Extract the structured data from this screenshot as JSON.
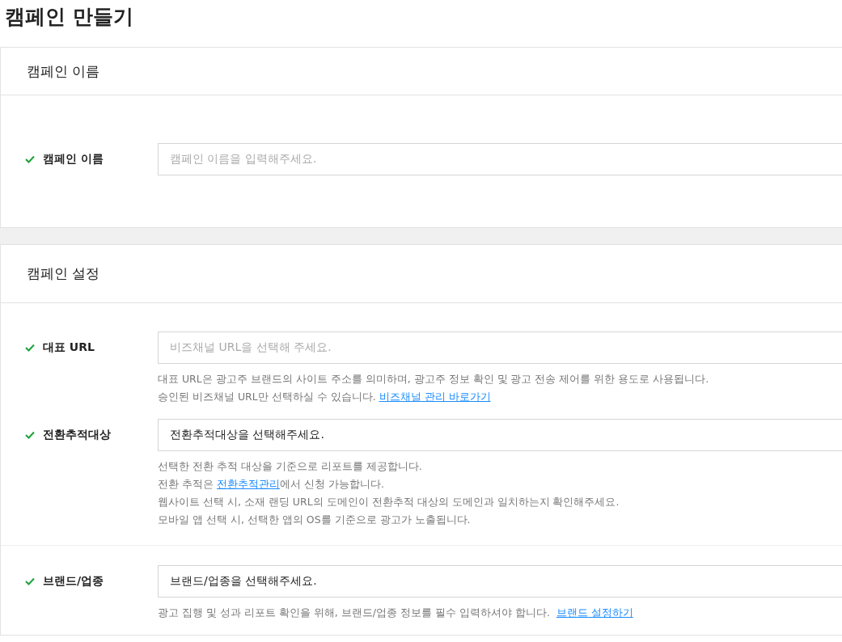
{
  "page_title": "캠페인 만들기",
  "sections": [
    {
      "title": "캠페인 이름",
      "fields": [
        {
          "label": "캠페인 이름",
          "valid": true,
          "kind": "input",
          "placeholder": "캠페인 이름을 입력해주세요."
        }
      ]
    },
    {
      "title": "캠페인 설정",
      "fields": [
        {
          "label": "대표 URL",
          "valid": true,
          "kind": "input",
          "placeholder": "비즈채널 URL을 선택해 주세요.",
          "help": [
            [
              {
                "text": "대표 URL은 광고주 브랜드의 사이트 주소를 의미하며, 광고주 정보 확인 및 광고 전송 제어를 위한 용도로 사용됩니다."
              }
            ],
            [
              {
                "text": "승인된 비즈채널 URL만 선택하실 수 있습니다. "
              },
              {
                "text": "비즈채널 관리 바로가기",
                "link": true
              }
            ]
          ]
        },
        {
          "label": "전환추적대상",
          "valid": true,
          "kind": "select",
          "value": "전환추적대상을 선택해주세요.",
          "divider_after": true,
          "help": [
            [
              {
                "text": "선택한 전환 추적 대상을 기준으로 리포트를 제공합니다."
              }
            ],
            [
              {
                "text": "전환 추적은 "
              },
              {
                "text": "전환추적관리",
                "link": true
              },
              {
                "text": "에서 신청 가능합니다."
              }
            ],
            [
              {
                "text": "웹사이트 선택 시, 소재 랜딩 URL의 도메인이 전환추적 대상의 도메인과 일치하는지 확인해주세요."
              }
            ],
            [
              {
                "text": "모바일 앱 선택 시, 선택한 앱의 OS를 기준으로 광고가 노출됩니다."
              }
            ]
          ]
        },
        {
          "label": "브랜드/업종",
          "valid": true,
          "kind": "select",
          "value": "브랜드/업종을 선택해주세요.",
          "help": [
            [
              {
                "text": "광고 집행 및 성과 리포트 확인을 위해, 브랜드/업종 정보를 필수 입력하셔야 합니다.  "
              },
              {
                "text": "브랜드 설정하기",
                "link": true
              }
            ]
          ]
        }
      ]
    }
  ]
}
